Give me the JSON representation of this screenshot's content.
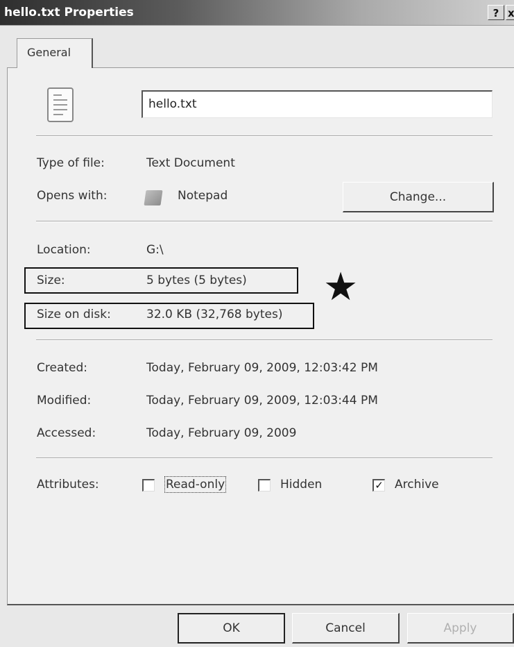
{
  "window": {
    "title": "hello.txt Properties",
    "help_button": "?",
    "close_button": "x"
  },
  "tabs": [
    {
      "label": "General",
      "selected": true
    }
  ],
  "general": {
    "file_icon": "text-file-icon",
    "file_name": "hello.txt",
    "type_label": "Type of file:",
    "type_value": "Text Document",
    "opens_label": "Opens with:",
    "opens_icon": "notepad-icon",
    "opens_value": "Notepad",
    "change_button": "Change...",
    "location_label": "Location:",
    "location_value": "G:\\",
    "size_label": "Size:",
    "size_value": "5 bytes (5 bytes)",
    "size_on_disk_label": "Size on disk:",
    "size_on_disk_value": "32.0 KB (32,768 bytes)",
    "annotation_star": "★",
    "created_label": "Created:",
    "created_value": "Today, February 09, 2009, 12:03:42 PM",
    "modified_label": "Modified:",
    "modified_value": "Today, February 09, 2009, 12:03:44 PM",
    "accessed_label": "Accessed:",
    "accessed_value": "Today, February 09, 2009",
    "attributes_label": "Attributes:",
    "attributes": [
      {
        "label": "Read-only",
        "checked": false
      },
      {
        "label": "Hidden",
        "checked": false
      },
      {
        "label": "Archive",
        "checked": true
      }
    ]
  },
  "footer": {
    "ok_button": "OK",
    "cancel_button": "Cancel",
    "apply_button": "Apply"
  }
}
